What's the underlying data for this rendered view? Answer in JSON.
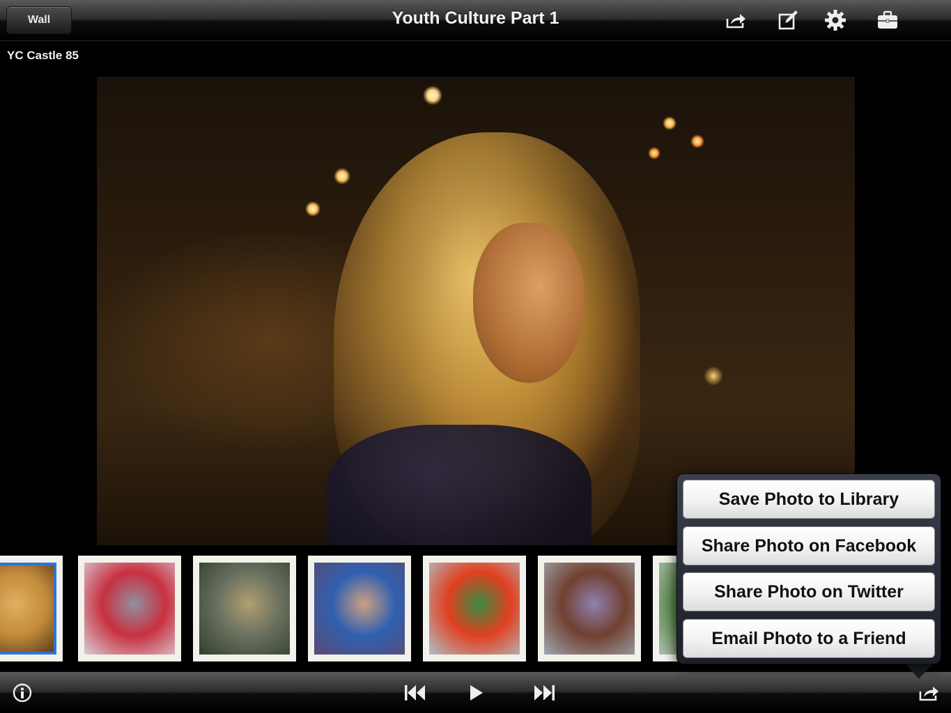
{
  "topbar": {
    "back_label": "Wall",
    "title": "Youth Culture Part 1",
    "icons": [
      "share-icon",
      "compose-icon",
      "gear-icon",
      "briefcase-icon"
    ]
  },
  "photo": {
    "caption": "YC Castle 85"
  },
  "filmstrip": {
    "thumbnails": [
      {
        "colors": [
          "#3a2510",
          "#c08a3a",
          "#e0b060"
        ],
        "selected": true
      },
      {
        "colors": [
          "#d8d0d8",
          "#c83040",
          "#9090a0"
        ],
        "selected": false
      },
      {
        "colors": [
          "#30402a",
          "#6a7060",
          "#b0a070"
        ],
        "selected": false
      },
      {
        "colors": [
          "#5a4a70",
          "#3060b0",
          "#d0a080"
        ],
        "selected": false
      },
      {
        "colors": [
          "#b0c0c8",
          "#e04020",
          "#3a8a40"
        ],
        "selected": false
      },
      {
        "colors": [
          "#a0a8b0",
          "#704030",
          "#9080b0"
        ],
        "selected": false
      },
      {
        "colors": [
          "#b0c0b0",
          "#508040",
          "#ffffff"
        ],
        "selected": false
      }
    ]
  },
  "share_menu": {
    "items": [
      "Save Photo to Library",
      "Share Photo on Facebook",
      "Share Photo on Twitter",
      "Email Photo to a Friend"
    ]
  },
  "bottombar": {
    "icons": [
      "info-icon",
      "previous-icon",
      "play-icon",
      "next-icon",
      "share-icon"
    ]
  },
  "colors": {
    "bar_dark": "#000000",
    "selected_thumb": "#2f74d8"
  }
}
